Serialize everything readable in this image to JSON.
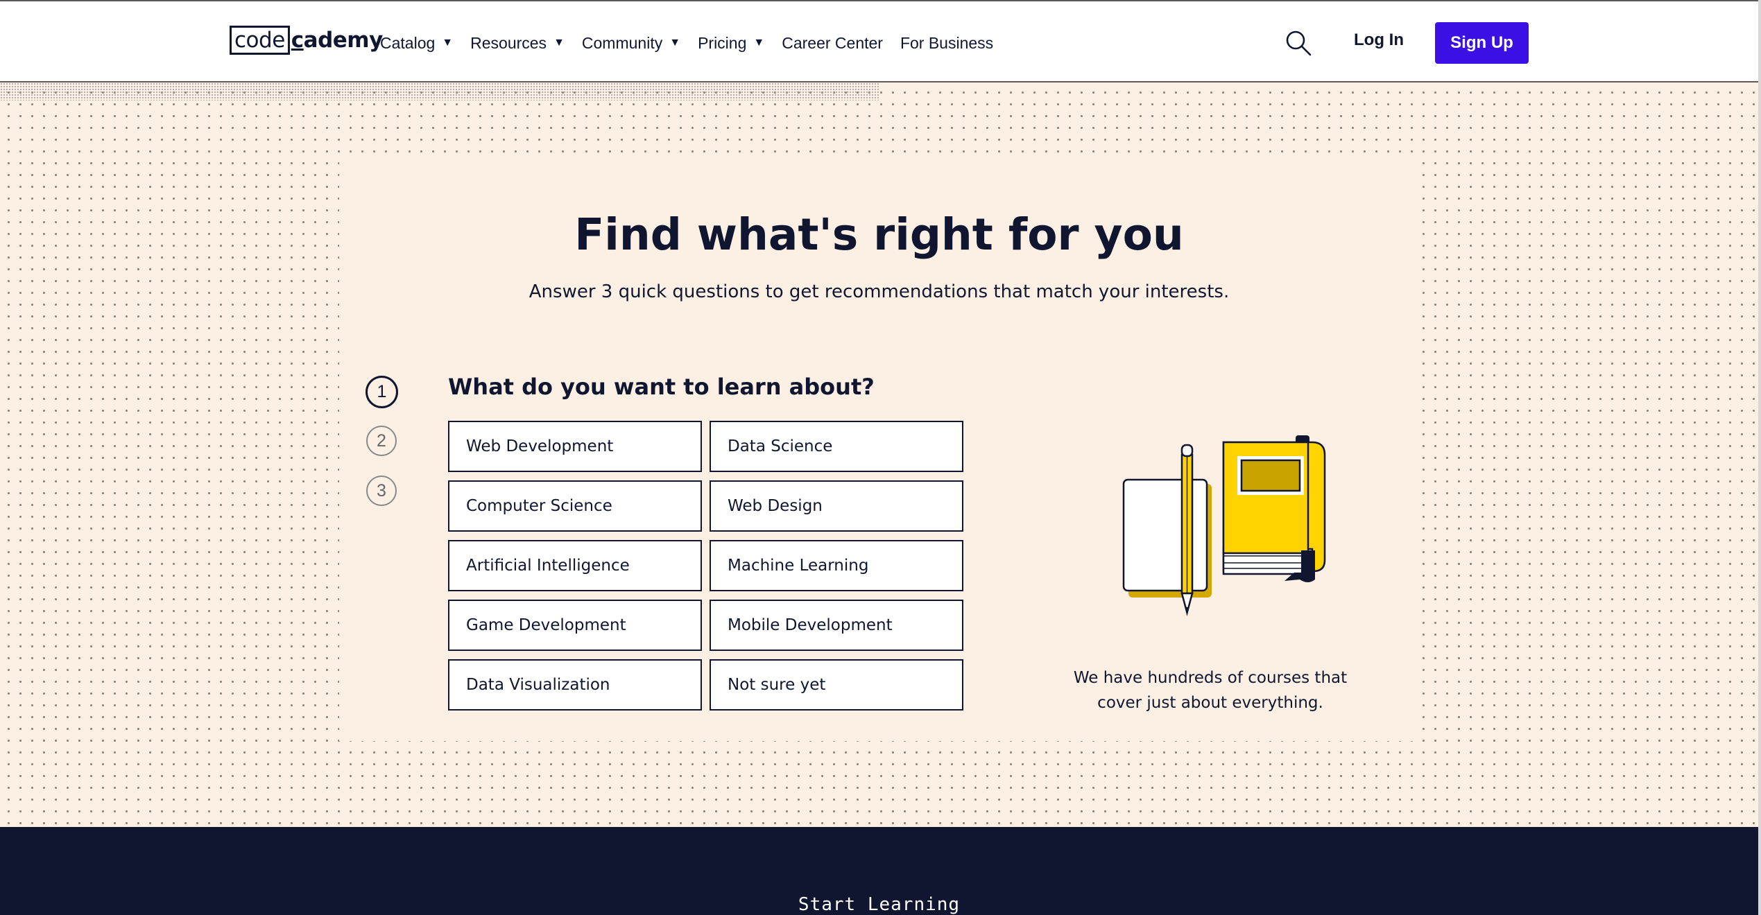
{
  "header": {
    "logo_box": "code",
    "logo_rest": "cademy",
    "nav": [
      {
        "label": "Catalog",
        "has_dropdown": true,
        "caret": "▼"
      },
      {
        "label": "Resources",
        "has_dropdown": true,
        "caret": "▼"
      },
      {
        "label": "Community",
        "has_dropdown": true,
        "caret": "▼"
      },
      {
        "label": "Pricing",
        "has_dropdown": true,
        "caret": "▼"
      },
      {
        "label": "Career Center",
        "has_dropdown": false
      },
      {
        "label": "For Business",
        "has_dropdown": false
      }
    ],
    "search_icon": "search-icon",
    "login_label": "Log In",
    "signup_label": "Sign Up"
  },
  "quiz": {
    "title": "Find what's right for you",
    "subtitle": "Answer 3 quick questions to get recommendations that match your interests.",
    "steps": [
      "1",
      "2",
      "3"
    ],
    "active_step": 1,
    "question": "What do you want to learn about?",
    "options": [
      "Web Development",
      "Data Science",
      "Computer Science",
      "Web Design",
      "Artificial Intelligence",
      "Machine Learning",
      "Game Development",
      "Mobile Development",
      "Data Visualization",
      "Not sure yet"
    ],
    "side_text_line1": "We have hundreds of courses that",
    "side_text_line2": "cover just about everything."
  },
  "footer": {
    "cta": "Start Learning"
  },
  "colors": {
    "brand_primary": "#3a10e5",
    "navy": "#10162f",
    "beige": "#fcefe4",
    "yellow": "#ffd300"
  }
}
